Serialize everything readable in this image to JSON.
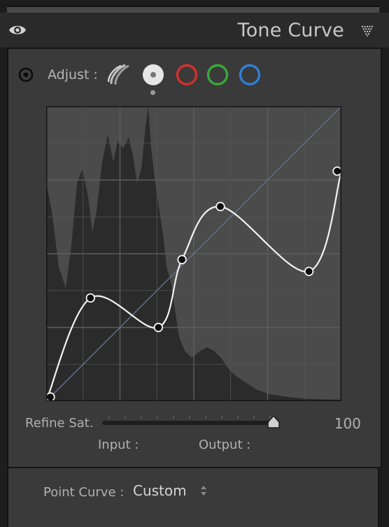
{
  "panel": {
    "title": "Tone Curve"
  },
  "icons": {
    "visibility": "eye-icon",
    "collapse": "collapse-triangle-icon",
    "target": "target-adjust-icon"
  },
  "adjust": {
    "label": "Adjust :",
    "channels": [
      {
        "id": "parametric",
        "color": "#bdbdbd"
      },
      {
        "id": "point-rgb",
        "color": "#e6e6e6",
        "selected": true
      },
      {
        "id": "red",
        "color": "#d2302e"
      },
      {
        "id": "green",
        "color": "#38a83a"
      },
      {
        "id": "blue",
        "color": "#2f7fd6"
      }
    ]
  },
  "curve": {
    "points": [
      [
        0,
        0
      ],
      [
        0.15,
        0.35
      ],
      [
        0.38,
        0.25
      ],
      [
        0.46,
        0.48
      ],
      [
        0.59,
        0.66
      ],
      [
        0.89,
        0.44
      ],
      [
        1,
        0.78
      ]
    ]
  },
  "refine": {
    "label": "Refine Sat.",
    "value": "100",
    "fraction": 1.0
  },
  "readout": {
    "input_label": "Input :",
    "output_label": "Output :"
  },
  "footer": {
    "point_curve_label": "Point Curve :",
    "point_curve_value": "Custom"
  }
}
